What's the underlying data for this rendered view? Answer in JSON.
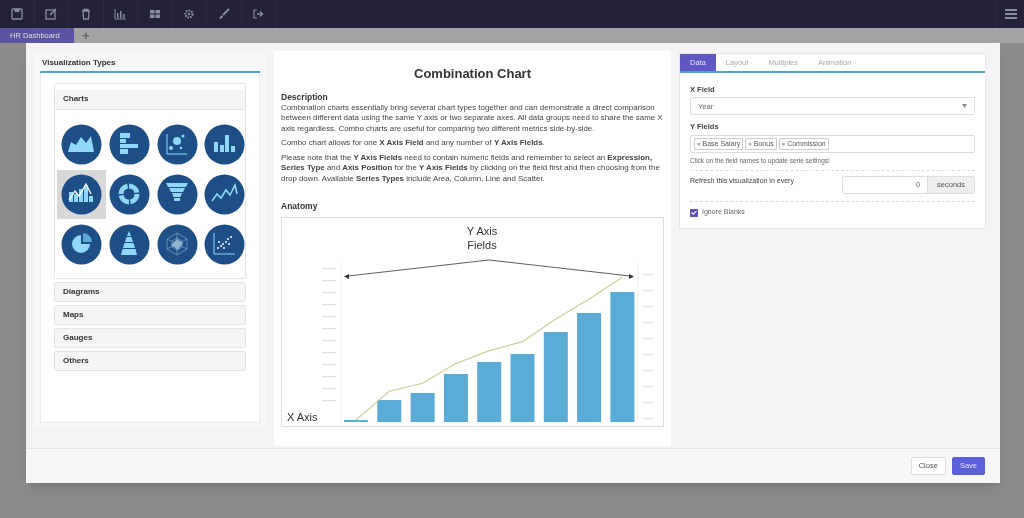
{
  "tabs": [
    {
      "label": "HR Dashboard",
      "selected": true
    }
  ],
  "add_tab": "+",
  "visualization_types": {
    "title": "Visualization Types",
    "sections": [
      {
        "label": "Charts",
        "expanded": true,
        "items": [
          {
            "kind": "area",
            "selected": false
          },
          {
            "kind": "bar",
            "selected": false
          },
          {
            "kind": "bubble",
            "selected": false
          },
          {
            "kind": "column",
            "selected": false
          },
          {
            "kind": "combination",
            "selected": true
          },
          {
            "kind": "donut",
            "selected": false
          },
          {
            "kind": "funnel",
            "selected": false
          },
          {
            "kind": "line",
            "selected": false
          },
          {
            "kind": "pie",
            "selected": false
          },
          {
            "kind": "pyramid",
            "selected": false
          },
          {
            "kind": "radar",
            "selected": false
          },
          {
            "kind": "scatter",
            "selected": false
          }
        ]
      },
      {
        "label": "Diagrams",
        "expanded": false
      },
      {
        "label": "Maps",
        "expanded": false
      },
      {
        "label": "Gauges",
        "expanded": false
      },
      {
        "label": "Others",
        "expanded": false
      }
    ]
  },
  "description": {
    "title": "Combination Chart",
    "heading": "Description",
    "paragraphs": [
      "Combination charts essentially bring several chart types together and can demonstrate a direct comparison between different data using the same Y axis or two separate axes. All data groups need to share the same X axis regardless. Combo charts are useful for comparing two different metrics side-by-side.",
      "Combo chart allows for one **X Axis Field** and any number of **Y Axis Fields**.",
      "Please note that the **Y Axis Fields** need to contain numeric fields and remember to select an **Expression, Series Type** and **Axis Position** for the **Y Axis Fields** by clicking on the field first and then choosing from the drop down.  Available **Series Types** include Area, Column, Line and Scatter."
    ],
    "anatomy_heading": "Anatomy",
    "anatomy": {
      "y_label": "Y Axis Fields",
      "x_label": "X Axis"
    }
  },
  "settings": {
    "tabs": [
      {
        "label": "Data",
        "selected": true
      },
      {
        "label": "Layout",
        "selected": false
      },
      {
        "label": "Multiples",
        "selected": false
      },
      {
        "label": "Animation",
        "selected": false
      }
    ],
    "x_field": {
      "label": "X Field",
      "value": "Year"
    },
    "y_fields": {
      "label": "Y Fields",
      "tags": [
        "Base Salary",
        "Bonus",
        "Commission"
      ],
      "tag_remove": "×",
      "hint": "Click on the field names to update serie settings!"
    },
    "refresh": {
      "label": "Refresh this visualization in every",
      "value": "0",
      "unit": "seconds"
    },
    "ignore_blanks": {
      "label": "Ignore Blanks",
      "checked": true
    }
  },
  "footer": {
    "buttons": [
      {
        "label": "Close",
        "kind": "secondary"
      },
      {
        "label": "Save",
        "kind": "primary"
      }
    ]
  }
}
